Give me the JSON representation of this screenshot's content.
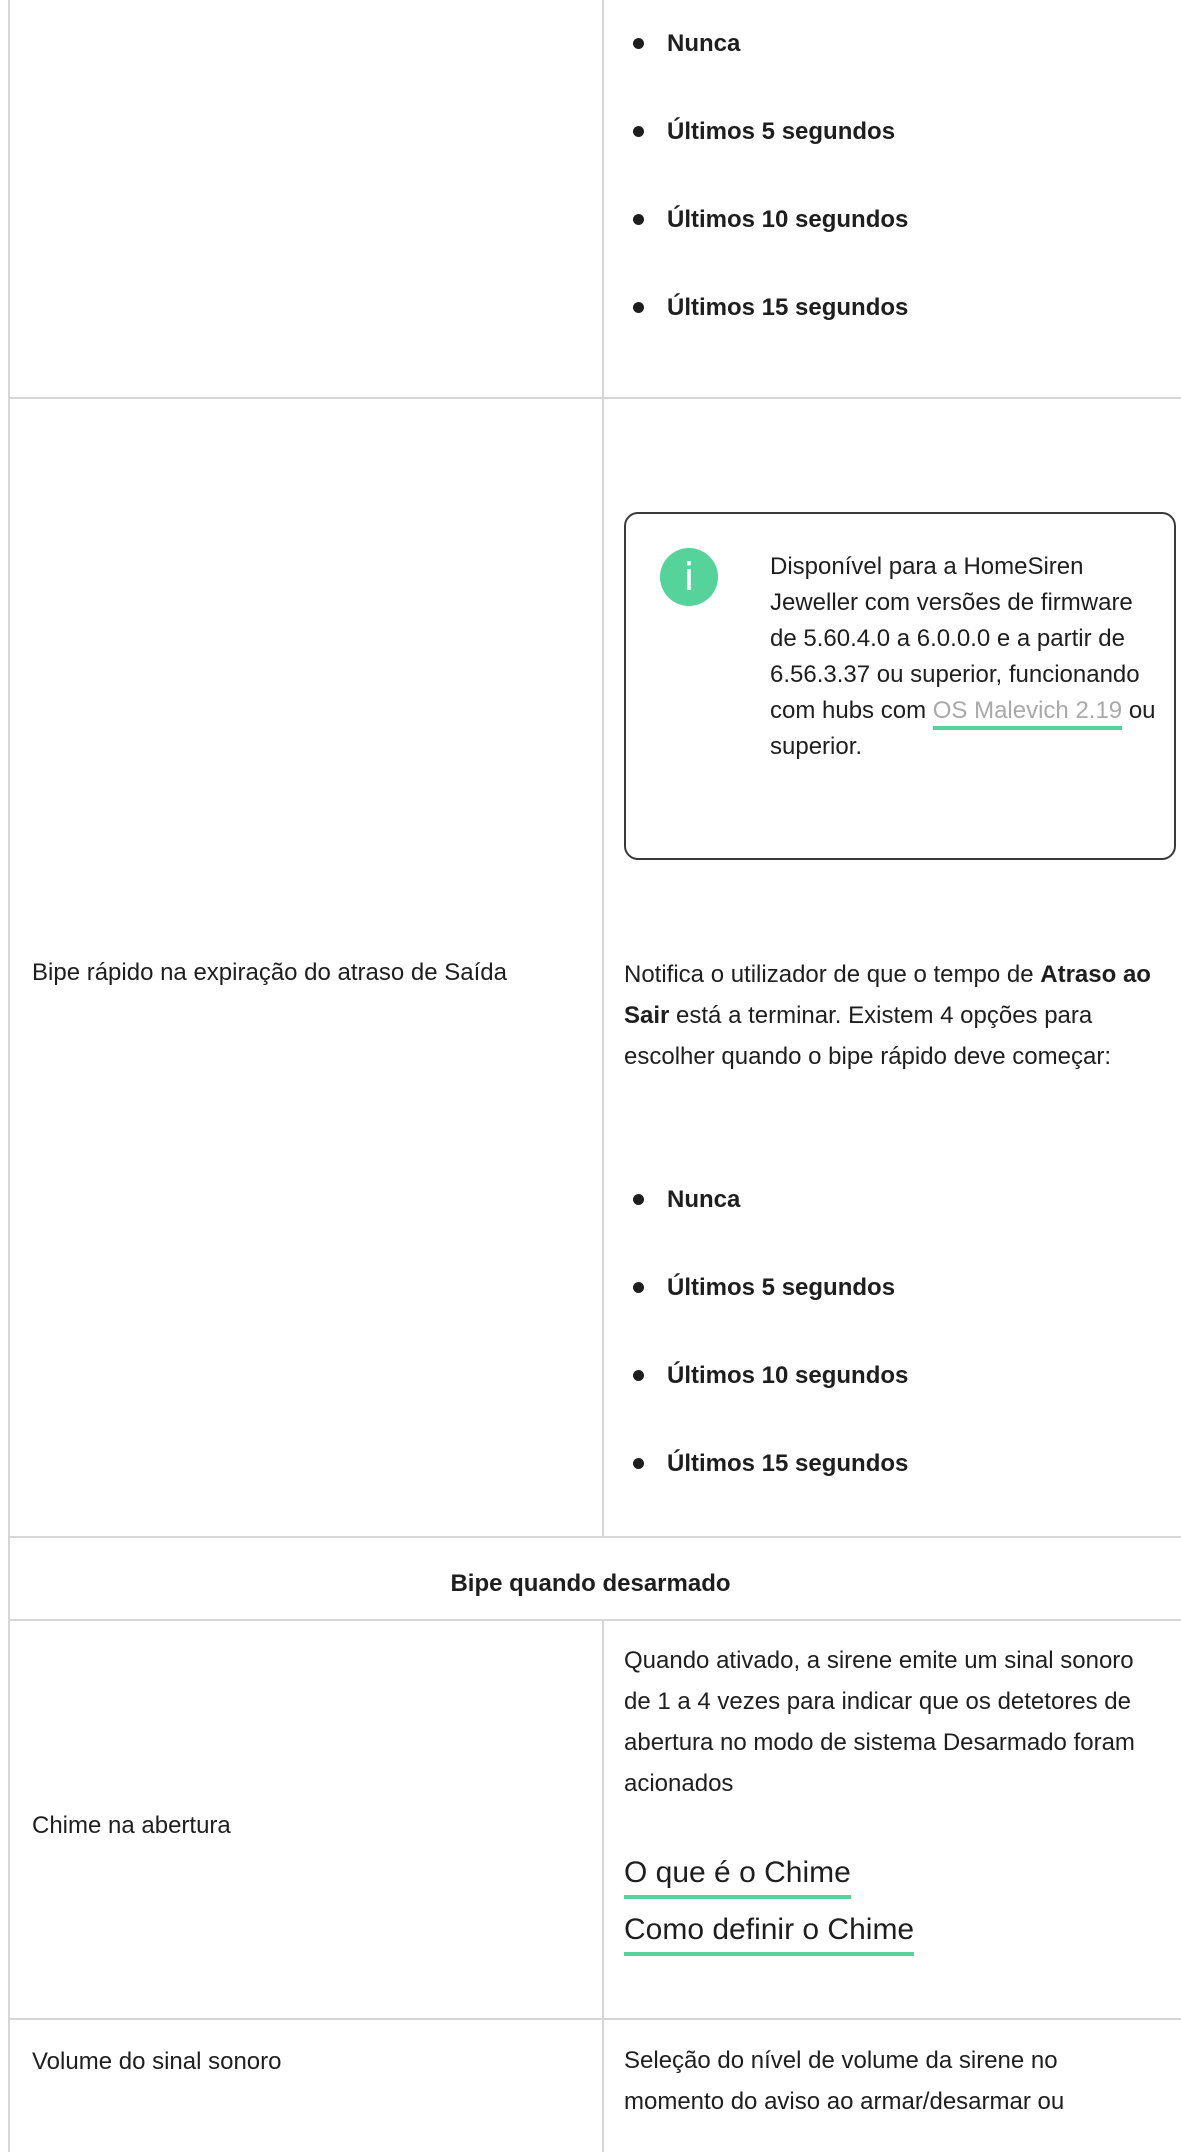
{
  "row1": {
    "options": [
      "Nunca",
      "Últimos 5 segundos",
      "Últimos 10 segundos",
      "Últimos 15 segundos"
    ]
  },
  "row2": {
    "label": "Bipe rápido na expiração do atraso de Saída",
    "note": {
      "icon": "info-icon",
      "text_before": "Disponível para a HomeSiren Jeweller com versões de firmware de 5.60.4.0 a 6.0.0.0 e a partir de 6.56.3.37 ou superior, funcionando com hubs com ",
      "link": "OS Malevich 2.19",
      "text_after": " ou superior."
    },
    "desc_before": "Notifica o utilizador de que o tempo de ",
    "desc_bold": "Atraso ao Sair",
    "desc_after": " está a terminar. Existem 4 opções para escolher quando o bipe rápido deve começar:",
    "options": [
      "Nunca",
      "Últimos 5 segundos",
      "Últimos 10 segundos",
      "Últimos 15 segundos"
    ]
  },
  "section_title": "Bipe quando desarmado",
  "row3": {
    "label": "Chime na abertura",
    "desc": "Quando ativado, a sirene emite um sinal sonoro de 1 a 4 vezes para indicar que os detetores de abertura no modo de sistema Desarmado foram acionados",
    "link1": "O que é o Chime",
    "link2": "Como definir o Chime"
  },
  "row4": {
    "label": "Volume do sinal sonoro",
    "desc": "Seleção do nível de volume da sirene no momento do aviso ao armar/desarmar ou"
  },
  "colors": {
    "accent": "#56d39a",
    "border": "#d6d6d6",
    "link_grey": "#a9a9a9"
  }
}
